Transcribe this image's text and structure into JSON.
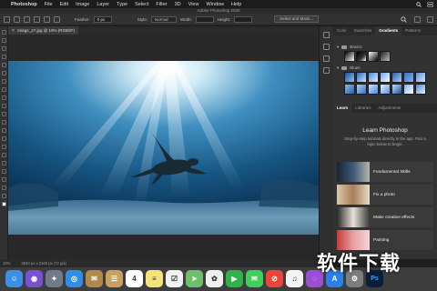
{
  "menubar": {
    "app": "Photoshop",
    "items": [
      "File",
      "Edit",
      "Image",
      "Layer",
      "Type",
      "Select",
      "Filter",
      "3D",
      "View",
      "Window",
      "Help"
    ]
  },
  "window": {
    "title": "Adobe Photoshop 2020"
  },
  "options": {
    "feather_label": "Feather:",
    "feather_value": "0 px",
    "style_label": "Style:",
    "style_value": "Normal",
    "width_label": "Width:",
    "height_label": "Height:",
    "select_mask_label": "Select and Mask..."
  },
  "document": {
    "tab_title": "Image_27.jpg @ 10% (RGB/8*)"
  },
  "status": {
    "zoom": "10%",
    "doc_size": "3840 px x 2160 px (72 ppi)"
  },
  "panels": {
    "tabs": [
      "Color",
      "Swatches",
      "Gradients",
      "Patterns"
    ],
    "active_tab": "Gradients",
    "groups": [
      {
        "name": "Basics",
        "swatches": [
          "#000000",
          "#ffffff",
          "#777777",
          "#222222"
        ]
      },
      {
        "name": "Blues",
        "swatches": [
          "#2a5ea8",
          "#4d86d8",
          "#7fb0ee",
          "#a8cff8",
          "#cfe6ff",
          "#5f8fd8",
          "#3c6fc5",
          "#8ab8f2"
        ]
      }
    ]
  },
  "learn": {
    "tabs": [
      "Learn",
      "Libraries",
      "Adjustments"
    ],
    "active_tab": "Learn",
    "title": "Learn Photoshop",
    "subtitle": "Step-by-step tutorials directly in the app. Pick a topic below to begin.",
    "items": [
      {
        "label": "Fundamental Skills"
      },
      {
        "label": "Fix a photo"
      },
      {
        "label": "Make creative effects"
      },
      {
        "label": "Painting"
      }
    ]
  },
  "dock": {
    "apps": [
      {
        "name": "Finder",
        "color": "#3d8fe6",
        "glyph": "☺"
      },
      {
        "name": "Siri",
        "color": "#7a4fd0",
        "glyph": "◉"
      },
      {
        "name": "Launchpad",
        "color": "#707a88",
        "glyph": "✦"
      },
      {
        "name": "Safari",
        "color": "#2f8fe8",
        "glyph": "◎"
      },
      {
        "name": "Mail",
        "color": "#b08a4a",
        "glyph": "✉"
      },
      {
        "name": "Contacts",
        "color": "#c8a060",
        "glyph": "☰"
      },
      {
        "name": "Calendar",
        "color": "#ffffff",
        "glyph": "4"
      },
      {
        "name": "Notes",
        "color": "#f5e27a",
        "glyph": "≡"
      },
      {
        "name": "Reminders",
        "color": "#f2f2f2",
        "glyph": "☑"
      },
      {
        "name": "Maps",
        "color": "#6dbf6a",
        "glyph": "➤"
      },
      {
        "name": "Photos",
        "color": "#f0f0f0",
        "glyph": "✿"
      },
      {
        "name": "FaceTime",
        "color": "#2fb24a",
        "glyph": "▶"
      },
      {
        "name": "Messages",
        "color": "#3fcf5a",
        "glyph": "✉"
      },
      {
        "name": "News",
        "color": "#e9453c",
        "glyph": "⊘"
      },
      {
        "name": "Music",
        "color": "#f4f4f4",
        "glyph": "♫"
      },
      {
        "name": "Podcasts",
        "color": "#9a4fd6",
        "glyph": "◌"
      },
      {
        "name": "App Store",
        "color": "#2a7fe8",
        "glyph": "A"
      },
      {
        "name": "System Preferences",
        "color": "#7d7d7d",
        "glyph": "⚙"
      },
      {
        "name": "Photoshop",
        "color": "#0b1d3a",
        "glyph": "Ps"
      }
    ]
  },
  "watermark": "软件下载"
}
